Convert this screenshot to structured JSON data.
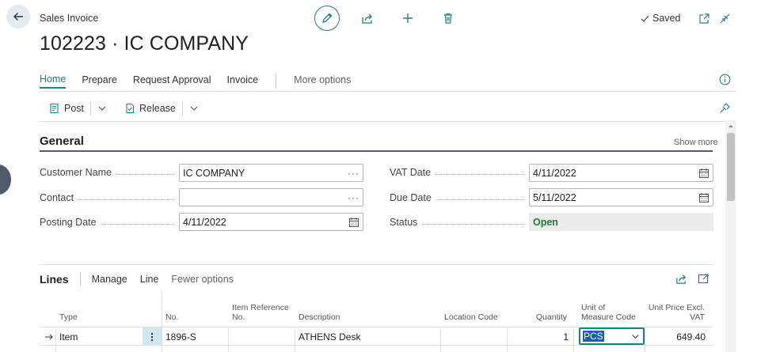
{
  "header": {
    "breadcrumb": "Sales Invoice",
    "title": "102223 · IC COMPANY",
    "saved_label": "Saved"
  },
  "tabs": [
    {
      "label": "Home",
      "active": true
    },
    {
      "label": "Prepare"
    },
    {
      "label": "Request Approval"
    },
    {
      "label": "Invoice"
    }
  ],
  "more_options": "More options",
  "actions": {
    "post": "Post",
    "release": "Release"
  },
  "general": {
    "title": "General",
    "show_more": "Show more",
    "fields": {
      "customer_name": {
        "label": "Customer Name",
        "value": "IC COMPANY"
      },
      "contact": {
        "label": "Contact",
        "value": ""
      },
      "posting_date": {
        "label": "Posting Date",
        "value": "4/11/2022"
      },
      "vat_date": {
        "label": "VAT Date",
        "value": "4/11/2022"
      },
      "due_date": {
        "label": "Due Date",
        "value": "5/11/2022"
      },
      "status": {
        "label": "Status",
        "value": "Open"
      }
    }
  },
  "lines": {
    "title": "Lines",
    "tabs": [
      "Manage",
      "Line",
      "Fewer options"
    ],
    "columns": {
      "type": "Type",
      "no": "No.",
      "item_ref_1": "Item Reference",
      "item_ref_2": "No.",
      "description": "Description",
      "location": "Location Code",
      "quantity": "Quantity",
      "uom_1": "Unit of",
      "uom_2": "Measure Code",
      "price_1": "Unit Price Excl.",
      "price_2": "VAT"
    },
    "rows": [
      {
        "type": "Item",
        "no": "1896-S",
        "item_ref": "",
        "description": "ATHENS Desk",
        "location": "",
        "quantity": "1",
        "uom": "PCS",
        "price": "649.40"
      }
    ]
  },
  "colors": {
    "accent": "#1e7f8c",
    "status_open": "#1f7a3a",
    "section_line": "#505a6b"
  }
}
